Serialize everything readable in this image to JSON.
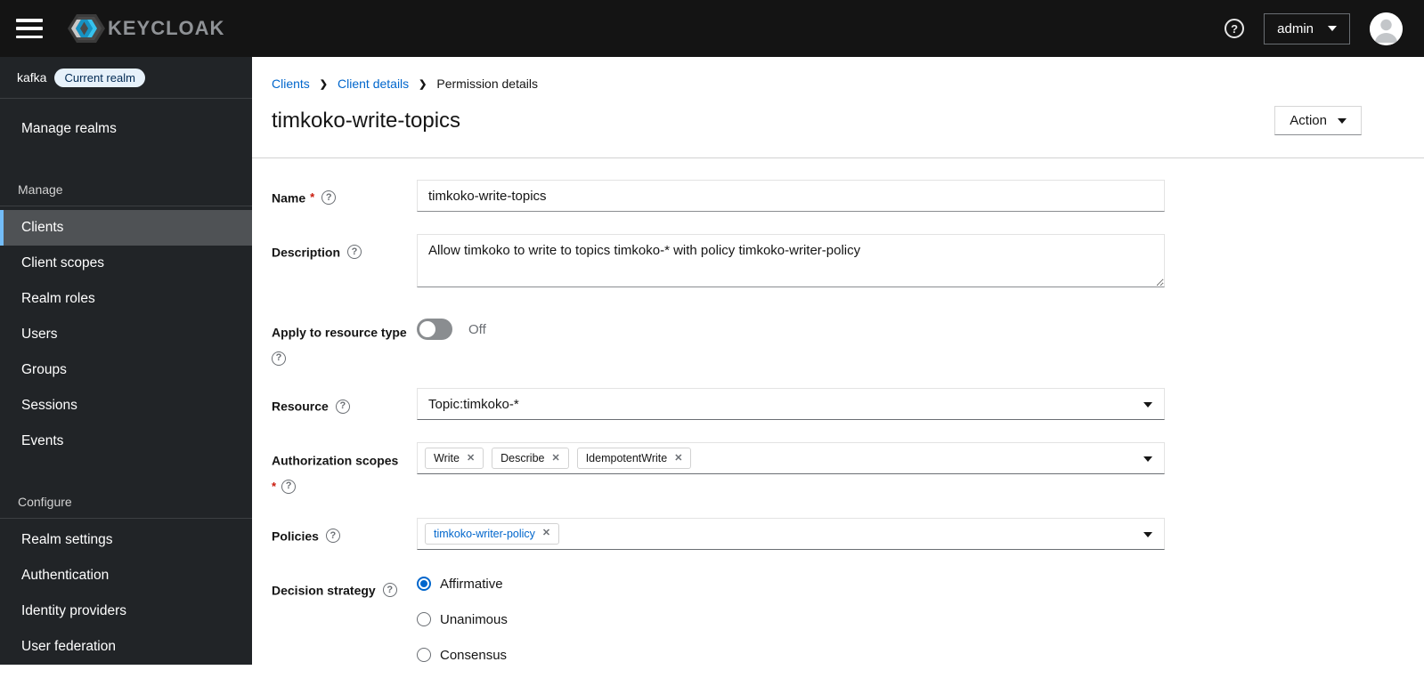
{
  "masthead": {
    "brand": "KEYCLOAK",
    "user": "admin"
  },
  "sidebar": {
    "realm_name": "kafka",
    "realm_badge": "Current realm",
    "top_item": "Manage realms",
    "sections": [
      {
        "label": "Manage",
        "items": [
          {
            "label": "Clients",
            "selected": true
          },
          {
            "label": "Client scopes"
          },
          {
            "label": "Realm roles"
          },
          {
            "label": "Users"
          },
          {
            "label": "Groups"
          },
          {
            "label": "Sessions"
          },
          {
            "label": "Events"
          }
        ]
      },
      {
        "label": "Configure",
        "items": [
          {
            "label": "Realm settings"
          },
          {
            "label": "Authentication"
          },
          {
            "label": "Identity providers"
          },
          {
            "label": "User federation"
          }
        ]
      }
    ]
  },
  "breadcrumb": {
    "items": [
      {
        "label": "Clients"
      },
      {
        "label": "Client details"
      },
      {
        "label": "Permission details"
      }
    ]
  },
  "page": {
    "title": "timkoko-write-topics",
    "action": "Action"
  },
  "form": {
    "name": {
      "label": "Name",
      "required": true,
      "value": "timkoko-write-topics"
    },
    "description": {
      "label": "Description",
      "value": "Allow timkoko to write to topics timkoko-* with policy timkoko-writer-policy"
    },
    "apply_to_resource_type": {
      "label": "Apply to resource type",
      "state": "Off"
    },
    "resource": {
      "label": "Resource",
      "value": "Topic:timkoko-*"
    },
    "authorization_scopes": {
      "label": "Authorization scopes",
      "required": true,
      "chips": [
        {
          "label": "Write"
        },
        {
          "label": "Describe"
        },
        {
          "label": "IdempotentWrite"
        }
      ]
    },
    "policies": {
      "label": "Policies",
      "chips": [
        {
          "label": "timkoko-writer-policy"
        }
      ]
    },
    "decision_strategy": {
      "label": "Decision strategy",
      "selected": "Affirmative",
      "options": [
        {
          "label": "Affirmative"
        },
        {
          "label": "Unanimous"
        },
        {
          "label": "Consensus"
        }
      ]
    }
  },
  "icons": {
    "menu": "hamburger-icon",
    "help": "question-circle-icon",
    "user": "avatar-icon",
    "caret": "chevron-down-icon",
    "chip_remove": "close-icon",
    "label_help": "question-circle-icon"
  },
  "colors": {
    "accent": "#0066cc",
    "nav_selected_border": "#73bcf7",
    "nav_selected_bg": "#4f5255",
    "masthead_bg": "#141414",
    "sidebar_bg": "#212427",
    "badge_bg": "#e7f1fa",
    "badge_text": "#002952",
    "required_asterisk": "#c9190b",
    "keycloak_cyan": "#2fb8e8"
  }
}
